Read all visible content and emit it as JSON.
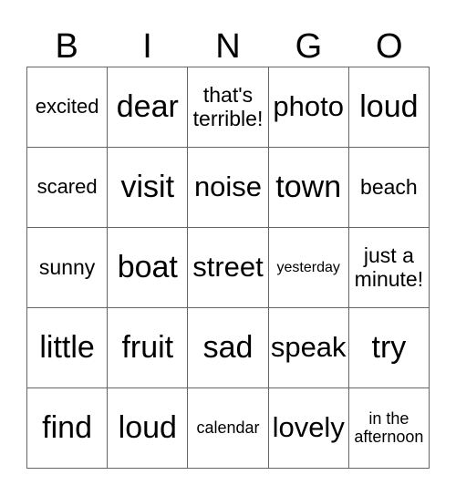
{
  "header": [
    "B",
    "I",
    "N",
    "G",
    "O"
  ],
  "cells": [
    [
      {
        "text": "excited",
        "size": "s-s"
      },
      {
        "text": "dear",
        "size": "s-xl"
      },
      {
        "text": "that's terrible!",
        "size": "s-m"
      },
      {
        "text": "photo",
        "size": "s-l"
      },
      {
        "text": "loud",
        "size": "s-xl"
      }
    ],
    [
      {
        "text": "scared",
        "size": "s-s"
      },
      {
        "text": "visit",
        "size": "s-xl"
      },
      {
        "text": "noise",
        "size": "s-l"
      },
      {
        "text": "town",
        "size": "s-xl"
      },
      {
        "text": "beach",
        "size": "s-m"
      }
    ],
    [
      {
        "text": "sunny",
        "size": "s-m"
      },
      {
        "text": "boat",
        "size": "s-xl"
      },
      {
        "text": "street",
        "size": "s-l"
      },
      {
        "text": "yesterday",
        "size": "s-xxs"
      },
      {
        "text": "just a minute!",
        "size": "s-m"
      }
    ],
    [
      {
        "text": "little",
        "size": "s-xl"
      },
      {
        "text": "fruit",
        "size": "s-xl"
      },
      {
        "text": "sad",
        "size": "s-xl"
      },
      {
        "text": "speak",
        "size": "s-l"
      },
      {
        "text": "try",
        "size": "s-xl"
      }
    ],
    [
      {
        "text": "find",
        "size": "s-xl"
      },
      {
        "text": "loud",
        "size": "s-xl"
      },
      {
        "text": "calendar",
        "size": "s-xs"
      },
      {
        "text": "lovely",
        "size": "s-l"
      },
      {
        "text": "in the afternoon",
        "size": "s-xs"
      }
    ]
  ]
}
